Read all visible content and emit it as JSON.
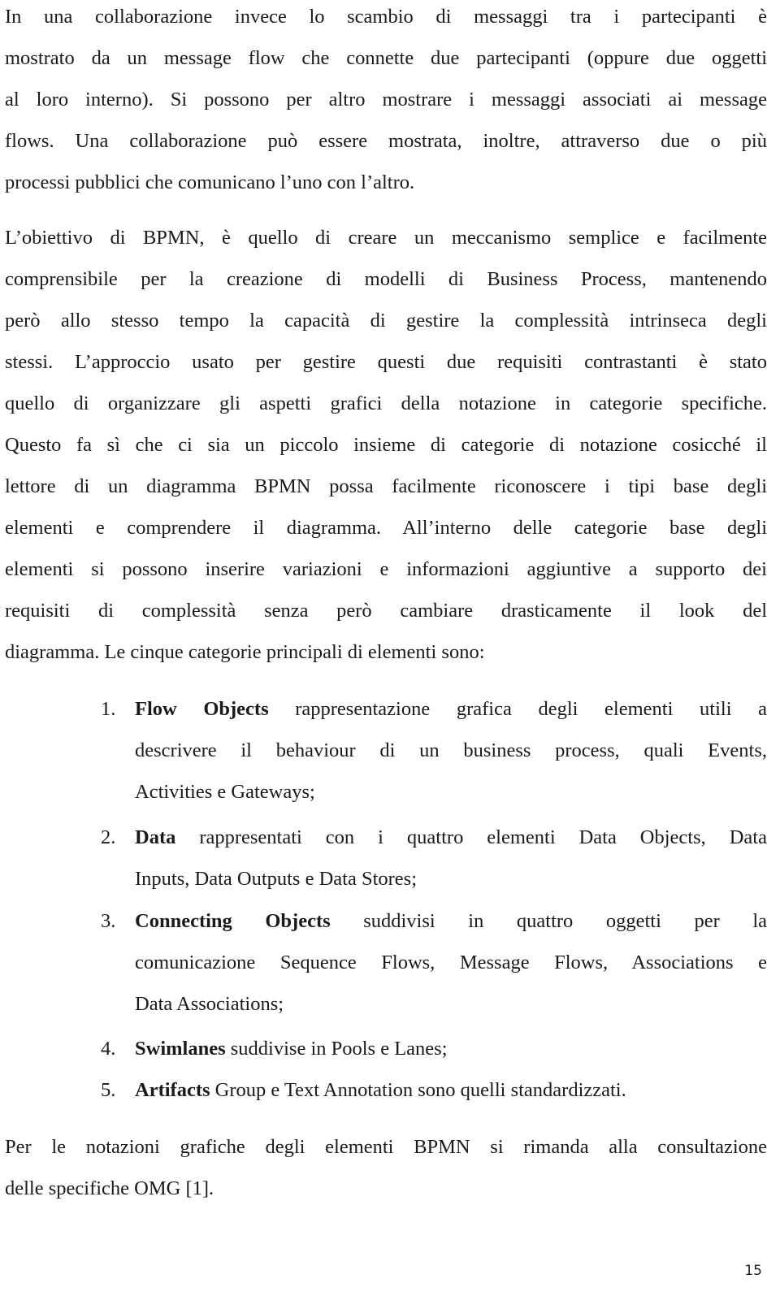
{
  "document": {
    "paragraphs": [
      {
        "lines": [
          "In una collaborazione invece lo scambio di messaggi tra i partecipanti è",
          "mostrato da un message flow che connette due partecipanti (oppure due oggetti",
          "al loro interno). Si possono per altro mostrare i messaggi associati ai message",
          "flows. Una collaborazione può essere mostrata, inoltre, attraverso due o più",
          "processi pubblici che comunicano l’uno con l’altro."
        ]
      },
      {
        "lines": [
          "L’obiettivo di BPMN, è quello di creare un meccanismo semplice e facilmente",
          "comprensibile per la creazione di modelli di Business Process, mantenendo",
          "però allo stesso tempo la capacità di gestire la complessità intrinseca degli",
          "stessi. L’approccio usato per gestire questi due requisiti contrastanti è stato",
          "quello di organizzare gli aspetti grafici della notazione in categorie specifiche.",
          "Questo fa sì che ci sia un piccolo insieme di categorie di notazione cosicché il",
          "lettore di un diagramma BPMN possa facilmente riconoscere i tipi base degli",
          "elementi e comprendere il diagramma. All’interno delle categorie base degli",
          "elementi si possono inserire variazioni e informazioni aggiuntive a supporto dei",
          "requisiti di complessità senza però cambiare drasticamente il look del",
          "diagramma. Le cinque categorie principali di elementi sono:"
        ]
      }
    ],
    "list": [
      {
        "number": "1.",
        "term": "Flow Objects",
        "first_line": " rappresentazione grafica degli elementi utili a",
        "continuation": [
          "descrivere il behaviour di un business process, quali Events,",
          "Activities e Gateways;"
        ]
      },
      {
        "number": "2.",
        "term": "Data",
        "first_line": " rappresentati con i quattro elementi Data Objects, Data",
        "continuation": [
          "Inputs, Data Outputs e Data Stores;"
        ]
      },
      {
        "number": "3.",
        "term": "Connecting Objects",
        "first_line": " suddivisi in quattro oggetti per la",
        "continuation": [
          "comunicazione Sequence Flows, Message Flows, Associations e",
          "Data Associations;"
        ]
      },
      {
        "number": "4.",
        "term": "Swimlanes",
        "first_line": " suddivise in Pools e Lanes;",
        "continuation": []
      },
      {
        "number": "5.",
        "term": "Artifacts",
        "first_line": " Group e Text Annotation sono quelli standardizzati.",
        "continuation": []
      }
    ],
    "closing": {
      "lines": [
        "Per le notazioni grafiche degli elementi BPMN si rimanda alla consultazione",
        "delle specifiche OMG [1]."
      ]
    },
    "page_number": "15"
  }
}
